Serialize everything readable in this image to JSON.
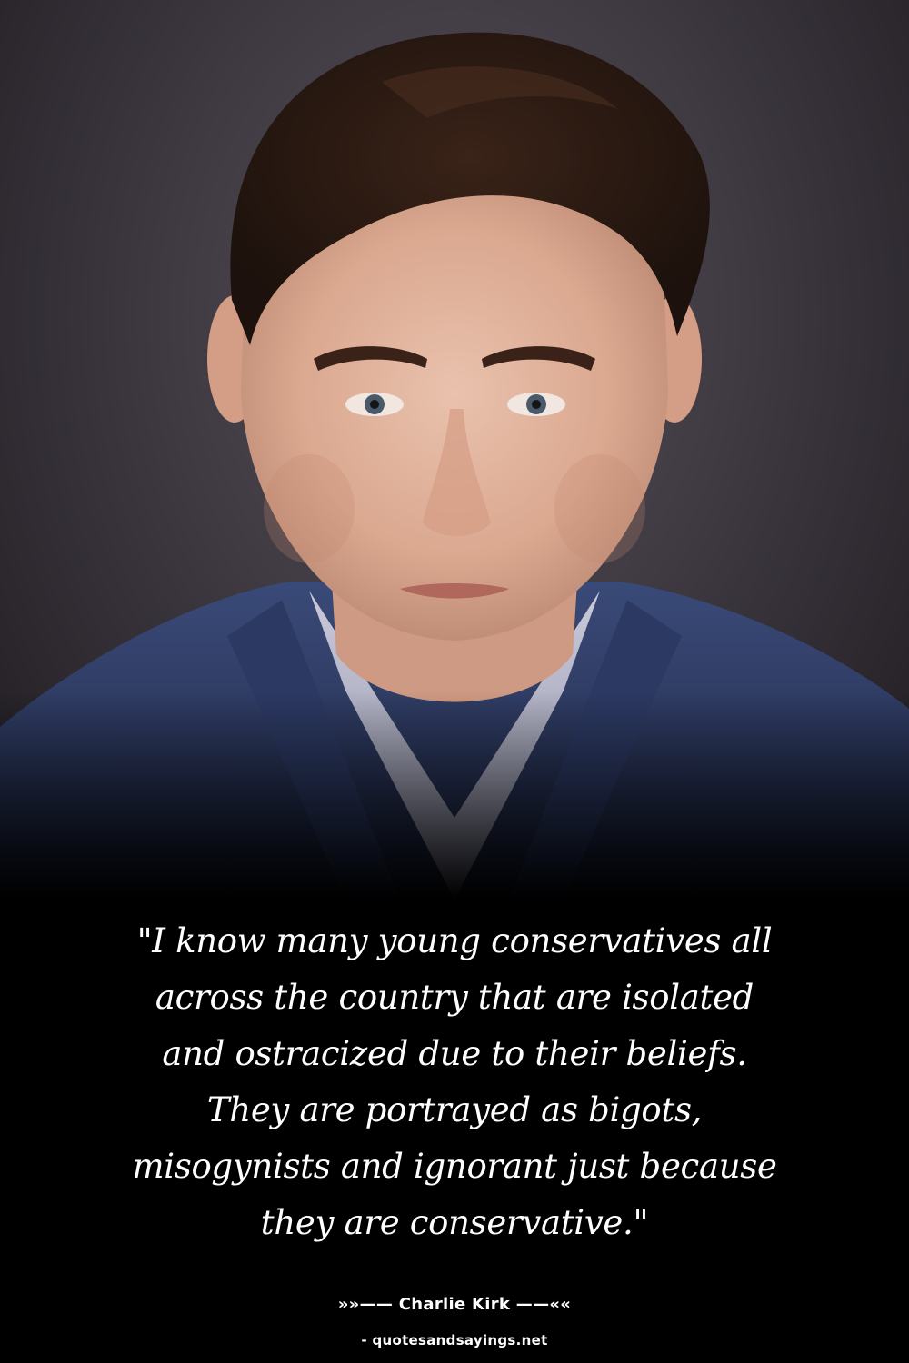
{
  "photo": {
    "subject": "portrait-of-man-in-blue-suit",
    "background_color": "#3f3a42"
  },
  "quote": {
    "lines": [
      "\"I know many young conservatives all",
      "across the country that are isolated",
      "and ostracized due to their beliefs.",
      "They are portrayed as bigots,",
      "misogynists and ignorant just because",
      "they are conservative.\""
    ]
  },
  "attribution": {
    "text": "»»—— Charlie Kirk ——««"
  },
  "source": {
    "text": "- quotesandsayings.net"
  },
  "colors": {
    "text": "#ffffff",
    "background": "#000000"
  }
}
